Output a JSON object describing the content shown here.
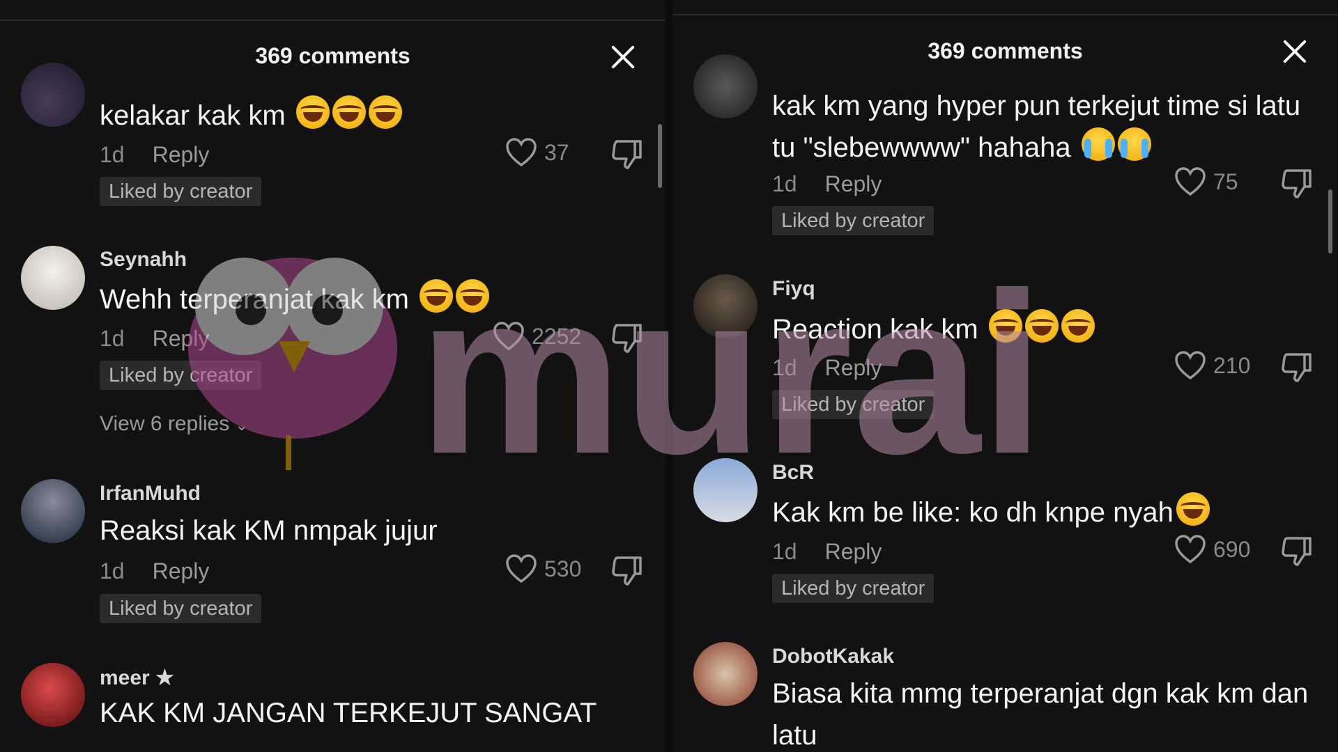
{
  "left_panel": {
    "title": "369 comments",
    "comments": [
      {
        "username": "",
        "text": "kelakar kak km",
        "emojis": [
          "laugh",
          "laugh",
          "laugh"
        ],
        "age": "1d",
        "reply": "Reply",
        "likes": "37",
        "badge": "Liked by creator"
      },
      {
        "username": "Seynahh",
        "text": "Wehh terperanjat kak km",
        "emojis": [
          "laugh",
          "laugh"
        ],
        "age": "1d",
        "reply": "Reply",
        "likes": "2252",
        "badge": "Liked by creator",
        "view_replies": "View 6 replies"
      },
      {
        "username": "IrfanMuhd",
        "text": "Reaksi kak KM nmpak jujur",
        "age": "1d",
        "reply": "Reply",
        "likes": "530",
        "badge": "Liked by creator"
      },
      {
        "username": "meer ★",
        "text": "KAK KM JANGAN TERKEJUT SANGAT"
      }
    ]
  },
  "right_panel": {
    "title": "369 comments",
    "comments": [
      {
        "username": "",
        "text": "kak km yang hyper pun terkejut time si latu tu \"slebewwww\" hahaha",
        "emojis": [
          "cry",
          "cry"
        ],
        "age": "1d",
        "reply": "Reply",
        "likes": "75",
        "badge": "Liked by creator"
      },
      {
        "username": "Fiyq",
        "text": "Reaction kak km",
        "emojis": [
          "laugh",
          "laugh",
          "laugh"
        ],
        "age": "1d",
        "reply": "Reply",
        "likes": "210",
        "badge": "Liked by creator"
      },
      {
        "username": "BcR",
        "text": "Kak km be like: ko dh knpe nyah",
        "emojis": [
          "laugh"
        ],
        "age": "1d",
        "reply": "Reply",
        "likes": "690",
        "badge": "Liked by creator"
      },
      {
        "username": "DobotKakak",
        "text": "Biasa kita mmg terperanjat dgn kak km dan latu"
      }
    ]
  },
  "watermark": {
    "text": "murai"
  },
  "colors": {
    "background": "#121212",
    "badge_bg": "#2b2b2b",
    "muted_text": "#8a8a8a",
    "watermark": "#c07aa8"
  }
}
